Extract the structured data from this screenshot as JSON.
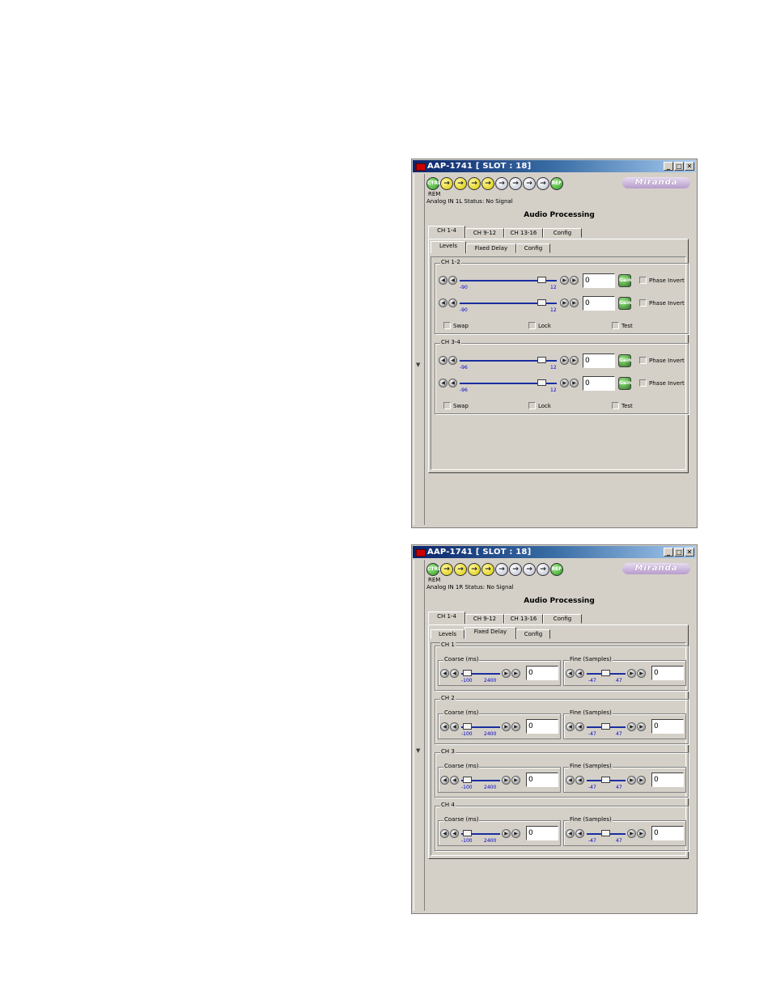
{
  "windows": [
    {
      "title": "AAP-1741 [ SLOT : 18]",
      "logo": "Miranda",
      "leds": [
        {
          "label": "CTRL",
          "color": "green",
          "icon": "status-led"
        },
        {
          "label": "→",
          "color": "yellow",
          "icon": "arrow-right-icon"
        },
        {
          "label": "→",
          "color": "yellow",
          "icon": "arrow-right-icon"
        },
        {
          "label": "→",
          "color": "yellow",
          "icon": "arrow-right-icon"
        },
        {
          "label": "→",
          "color": "yellow",
          "icon": "arrow-right-icon"
        },
        {
          "label": "→",
          "color": "gray",
          "icon": "arrow-right-icon"
        },
        {
          "label": "→",
          "color": "gray",
          "icon": "arrow-right-icon"
        },
        {
          "label": "→",
          "color": "gray",
          "icon": "arrow-right-icon"
        },
        {
          "label": "→",
          "color": "gray",
          "icon": "arrow-right-icon"
        },
        {
          "label": "REF",
          "color": "green",
          "icon": "status-led"
        }
      ],
      "rem": "REM",
      "status": "Analog IN 1L Status: No Signal",
      "heading": "Audio Processing",
      "main_tabs": [
        "CH 1-4",
        "CH 9-12",
        "CH 13-16",
        "Config"
      ],
      "sub_tabs": [
        "Levels",
        "Fixed Delay",
        "Config"
      ],
      "active_sub_tab": 0,
      "groups": [
        {
          "label": "CH 1-2",
          "rows": [
            {
              "min": "-90",
              "max": "12",
              "value": "0",
              "level": 0.88,
              "phase": "Phase Invert"
            },
            {
              "min": "-90",
              "max": "12",
              "value": "0",
              "level": 0.88,
              "phase": "Phase Invert"
            }
          ],
          "checks": [
            "Swap",
            "Lock",
            "Test"
          ]
        },
        {
          "label": "CH 3-4",
          "rows": [
            {
              "min": "-96",
              "max": "12",
              "value": "0",
              "level": 0.88,
              "phase": "Phase Invert"
            },
            {
              "min": "-96",
              "max": "12",
              "value": "0",
              "level": 0.88,
              "phase": "Phase Invert"
            }
          ],
          "checks": [
            "Swap",
            "Lock",
            "Test"
          ]
        }
      ],
      "gain_button": "Gain"
    },
    {
      "title": "AAP-1741 [ SLOT : 18]",
      "logo": "Miranda",
      "rem": "REM",
      "status": "Analog IN 1R Status: No Signal",
      "heading": "Audio Processing",
      "main_tabs": [
        "CH 1-4",
        "CH 9-12",
        "CH 13-16",
        "Config"
      ],
      "sub_tabs": [
        "Levels",
        "Fixed Delay",
        "Config"
      ],
      "active_sub_tab": 1,
      "delay_groups": [
        {
          "label": "CH 1",
          "coarse_label": "Coarse (ms)",
          "coarse_min": "-100",
          "coarse_max": "2400",
          "coarse_value": "0",
          "fine_label": "Fine (Samples)",
          "fine_min": "-47",
          "fine_max": "47",
          "fine_value": "0"
        },
        {
          "label": "CH 2",
          "coarse_label": "Coarse (ms)",
          "coarse_min": "-100",
          "coarse_max": "2400",
          "coarse_value": "0",
          "fine_label": "Fine (Samples)",
          "fine_min": "-47",
          "fine_max": "47",
          "fine_value": "0"
        },
        {
          "label": "CH 3",
          "coarse_label": "Coarse (ms)",
          "coarse_min": "-100",
          "coarse_max": "2400",
          "coarse_value": "0",
          "fine_label": "Fine (Samples)",
          "fine_min": "-47",
          "fine_max": "47",
          "fine_value": "0"
        },
        {
          "label": "CH 4",
          "coarse_label": "Coarse (ms)",
          "coarse_min": "-100",
          "coarse_max": "2400",
          "coarse_value": "0",
          "fine_label": "Fine (Samples)",
          "fine_min": "-47",
          "fine_max": "47",
          "fine_value": "0"
        }
      ]
    }
  ],
  "window_buttons": {
    "minimize": "_",
    "maximize": "□",
    "close": "✕"
  },
  "scroll_arrow": "▼",
  "nudge": {
    "fast_left": "◀◀",
    "left": "◀",
    "right": "▶",
    "fast_right": "▶▶"
  }
}
